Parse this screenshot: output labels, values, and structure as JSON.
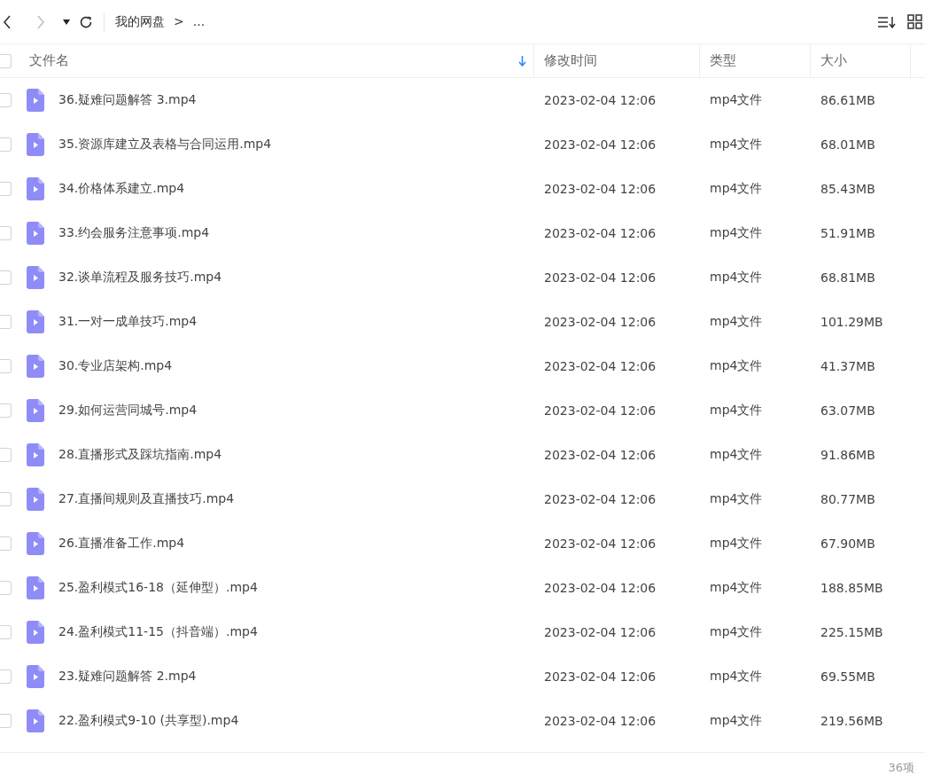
{
  "toolbar": {
    "breadcrumb": [
      "我的网盘",
      ">",
      "..."
    ]
  },
  "table": {
    "header_checked": false,
    "columns": [
      {
        "label": "文件名",
        "sorted": true
      },
      {
        "label": "修改时间",
        "sorted": false
      },
      {
        "label": "类型",
        "sorted": false
      },
      {
        "label": "大小",
        "sorted": false
      }
    ],
    "rows": [
      {
        "checked": false,
        "name": "36.疑难问题解答 3.mp4",
        "modified": "2023-02-04 12:06",
        "type": "mp4文件",
        "size": "86.61MB"
      },
      {
        "checked": false,
        "name": "35.资源库建立及表格与合同运用.mp4",
        "modified": "2023-02-04 12:06",
        "type": "mp4文件",
        "size": "68.01MB"
      },
      {
        "checked": false,
        "name": "34.价格体系建立.mp4",
        "modified": "2023-02-04 12:06",
        "type": "mp4文件",
        "size": "85.43MB"
      },
      {
        "checked": false,
        "name": "33.约会服务注意事项.mp4",
        "modified": "2023-02-04 12:06",
        "type": "mp4文件",
        "size": "51.91MB"
      },
      {
        "checked": false,
        "name": "32.谈单流程及服务技巧.mp4",
        "modified": "2023-02-04 12:06",
        "type": "mp4文件",
        "size": "68.81MB"
      },
      {
        "checked": false,
        "name": "31.一对一成单技巧.mp4",
        "modified": "2023-02-04 12:06",
        "type": "mp4文件",
        "size": "101.29MB"
      },
      {
        "checked": false,
        "name": "30.专业店架构.mp4",
        "modified": "2023-02-04 12:06",
        "type": "mp4文件",
        "size": "41.37MB"
      },
      {
        "checked": false,
        "name": "29.如何运营同城号.mp4",
        "modified": "2023-02-04 12:06",
        "type": "mp4文件",
        "size": "63.07MB"
      },
      {
        "checked": false,
        "name": "28.直播形式及踩坑指南.mp4",
        "modified": "2023-02-04 12:06",
        "type": "mp4文件",
        "size": "91.86MB"
      },
      {
        "checked": false,
        "name": "27.直播间规则及直播技巧.mp4",
        "modified": "2023-02-04 12:06",
        "type": "mp4文件",
        "size": "80.77MB"
      },
      {
        "checked": false,
        "name": "26.直播准备工作.mp4",
        "modified": "2023-02-04 12:06",
        "type": "mp4文件",
        "size": "67.90MB"
      },
      {
        "checked": false,
        "name": "25.盈利模式16-18（延伸型）.mp4",
        "modified": "2023-02-04 12:06",
        "type": "mp4文件",
        "size": "188.85MB"
      },
      {
        "checked": false,
        "name": "24.盈利模式11-15（抖音端）.mp4",
        "modified": "2023-02-04 12:06",
        "type": "mp4文件",
        "size": "225.15MB"
      },
      {
        "checked": false,
        "name": "23.疑难问题解答 2.mp4",
        "modified": "2023-02-04 12:06",
        "type": "mp4文件",
        "size": "69.55MB"
      },
      {
        "checked": false,
        "name": "22.盈利模式9-10 (共享型).mp4",
        "modified": "2023-02-04 12:06",
        "type": "mp4文件",
        "size": "219.56MB"
      }
    ]
  },
  "status_bar": {
    "count": "36项"
  }
}
